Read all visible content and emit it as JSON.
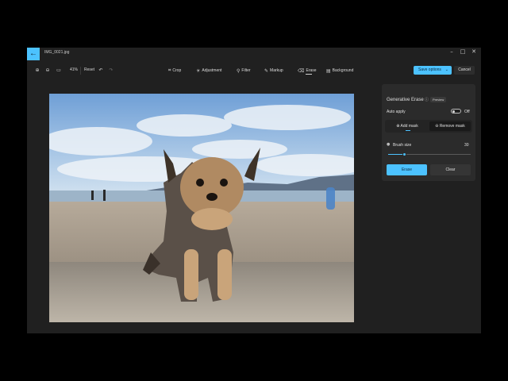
{
  "app": {
    "file_name": "IMG_0021.jpg",
    "back_icon": "arrow-left-icon",
    "window_controls": [
      "minimize-icon",
      "maximize-icon",
      "close-icon"
    ]
  },
  "toolbar": {
    "zoom_level": "41%",
    "reset_label": "Reset",
    "tools": [
      {
        "label": "Crop",
        "icon": "crop-icon"
      },
      {
        "label": "Adjustment",
        "icon": "adjustment-icon"
      },
      {
        "label": "Filter",
        "icon": "filter-icon"
      },
      {
        "label": "Markup",
        "icon": "markup-icon"
      },
      {
        "label": "Erase",
        "icon": "erase-icon",
        "active": true
      },
      {
        "label": "Background",
        "icon": "background-icon"
      }
    ],
    "save_label": "Save options",
    "cancel_label": "Cancel"
  },
  "panel": {
    "title": "Generative Erase",
    "preview_badge": "Preview",
    "auto_apply_label": "Auto apply",
    "auto_apply_state": "Off",
    "add_mask_label": "Add mask",
    "remove_mask_label": "Remove mask",
    "brush_size_label": "Brush size",
    "brush_size_value": "30",
    "brush_size_fraction": 0.2,
    "erase_label": "Erase",
    "clear_label": "Clear"
  },
  "colors": {
    "accent": "#4cc2ff",
    "window_bg": "#202020",
    "panel_bg": "#2b2b2b"
  }
}
